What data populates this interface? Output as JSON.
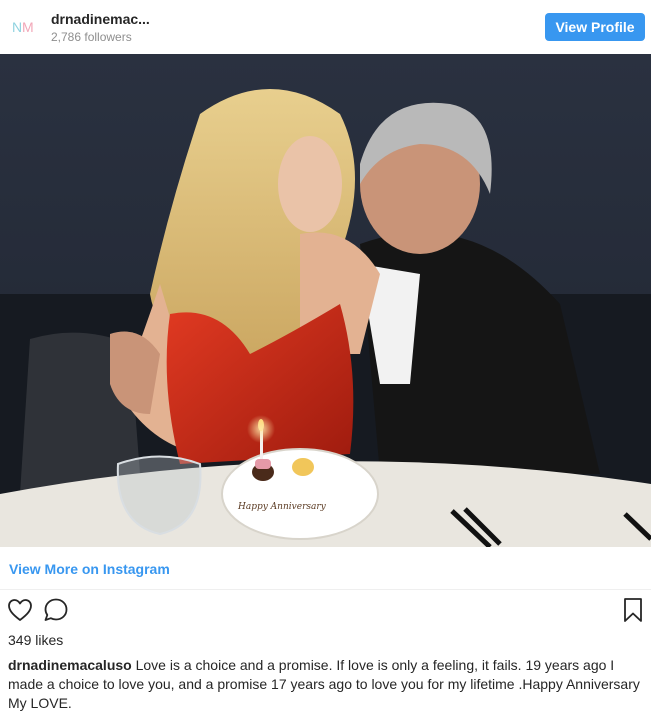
{
  "header": {
    "avatar_text": "NM",
    "username": "drnadinemac...",
    "followers": "2,786 followers",
    "view_profile_label": "View Profile"
  },
  "photo": {
    "cake_inscription": "Happy Anniversary"
  },
  "links": {
    "view_more": "View More on Instagram"
  },
  "actions": {
    "like_icon": "heart-icon",
    "comment_icon": "comment-icon",
    "save_icon": "bookmark-icon"
  },
  "post": {
    "likes": "349 likes",
    "caption_username": "drnadinemacaluso",
    "caption_text": "Love is a choice and a promise. If love is only a feeling, it fails. 19 years ago I made a choice to love you, and a promise 17 years ago to love you for my lifetime .Happy Anniversary My LOVE."
  },
  "colors": {
    "accent": "#3897f0",
    "text": "#262626",
    "muted": "#8e8e8e"
  }
}
